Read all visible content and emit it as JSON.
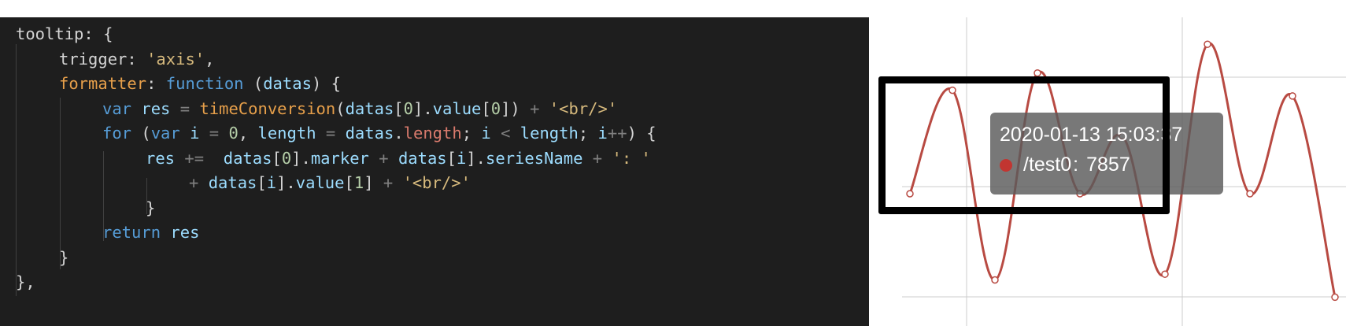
{
  "code": {
    "lines": [
      {
        "tokens": [
          {
            "t": "tooltip: {",
            "c": "tok-plain"
          }
        ]
      },
      {
        "tokens": [
          {
            "t": "trigger: ",
            "c": "tok-plain"
          },
          {
            "t": "'axis'",
            "c": "tok-str"
          },
          {
            "t": ",",
            "c": "tok-plain"
          }
        ]
      },
      {
        "tokens": [
          {
            "t": "formatter",
            "c": "tok-fn2"
          },
          {
            "t": ": ",
            "c": "tok-plain"
          },
          {
            "t": "function",
            "c": "tok-kw"
          },
          {
            "t": " (",
            "c": "tok-plain"
          },
          {
            "t": "datas",
            "c": "tok-var"
          },
          {
            "t": ") {",
            "c": "tok-plain"
          }
        ]
      },
      {
        "tokens": [
          {
            "t": "var ",
            "c": "tok-kw"
          },
          {
            "t": "res",
            "c": "tok-var"
          },
          {
            "t": " = ",
            "c": "tok-op"
          },
          {
            "t": "timeConversion",
            "c": "tok-fn2"
          },
          {
            "t": "(",
            "c": "tok-plain"
          },
          {
            "t": "datas",
            "c": "tok-var"
          },
          {
            "t": "[",
            "c": "tok-plain"
          },
          {
            "t": "0",
            "c": "tok-num"
          },
          {
            "t": "].",
            "c": "tok-plain"
          },
          {
            "t": "value",
            "c": "tok-var"
          },
          {
            "t": "[",
            "c": "tok-plain"
          },
          {
            "t": "0",
            "c": "tok-num"
          },
          {
            "t": "]) ",
            "c": "tok-plain"
          },
          {
            "t": "+ ",
            "c": "tok-op"
          },
          {
            "t": "'<br/>'",
            "c": "tok-str"
          }
        ]
      },
      {
        "tokens": [
          {
            "t": "for",
            "c": "tok-kw"
          },
          {
            "t": " (",
            "c": "tok-plain"
          },
          {
            "t": "var ",
            "c": "tok-kw"
          },
          {
            "t": "i",
            "c": "tok-var"
          },
          {
            "t": " = ",
            "c": "tok-op"
          },
          {
            "t": "0",
            "c": "tok-num"
          },
          {
            "t": ", ",
            "c": "tok-plain"
          },
          {
            "t": "length",
            "c": "tok-var"
          },
          {
            "t": " = ",
            "c": "tok-op"
          },
          {
            "t": "datas",
            "c": "tok-var"
          },
          {
            "t": ".",
            "c": "tok-plain"
          },
          {
            "t": "length",
            "c": "tok-prop3"
          },
          {
            "t": "; ",
            "c": "tok-plain"
          },
          {
            "t": "i",
            "c": "tok-var"
          },
          {
            "t": " < ",
            "c": "tok-op"
          },
          {
            "t": "length",
            "c": "tok-var"
          },
          {
            "t": "; ",
            "c": "tok-plain"
          },
          {
            "t": "i",
            "c": "tok-var"
          },
          {
            "t": "++",
            "c": "tok-op"
          },
          {
            "t": ") {",
            "c": "tok-plain"
          }
        ]
      },
      {
        "tokens": [
          {
            "t": "res",
            "c": "tok-var"
          },
          {
            "t": " +=  ",
            "c": "tok-op"
          },
          {
            "t": "datas",
            "c": "tok-var"
          },
          {
            "t": "[",
            "c": "tok-plain"
          },
          {
            "t": "0",
            "c": "tok-num"
          },
          {
            "t": "].",
            "c": "tok-plain"
          },
          {
            "t": "marker",
            "c": "tok-var"
          },
          {
            "t": " + ",
            "c": "tok-op"
          },
          {
            "t": "datas",
            "c": "tok-var"
          },
          {
            "t": "[",
            "c": "tok-plain"
          },
          {
            "t": "i",
            "c": "tok-var"
          },
          {
            "t": "].",
            "c": "tok-plain"
          },
          {
            "t": "seriesName",
            "c": "tok-var"
          },
          {
            "t": " + ",
            "c": "tok-op"
          },
          {
            "t": "': '",
            "c": "tok-str"
          }
        ]
      },
      {
        "tokens": [
          {
            "t": "+ ",
            "c": "tok-op"
          },
          {
            "t": "datas",
            "c": "tok-var"
          },
          {
            "t": "[",
            "c": "tok-plain"
          },
          {
            "t": "i",
            "c": "tok-var"
          },
          {
            "t": "].",
            "c": "tok-plain"
          },
          {
            "t": "value",
            "c": "tok-var"
          },
          {
            "t": "[",
            "c": "tok-plain"
          },
          {
            "t": "1",
            "c": "tok-num"
          },
          {
            "t": "] ",
            "c": "tok-plain"
          },
          {
            "t": "+ ",
            "c": "tok-op"
          },
          {
            "t": "'<br/>'",
            "c": "tok-str"
          }
        ]
      },
      {
        "tokens": [
          {
            "t": "}",
            "c": "tok-plain"
          }
        ]
      },
      {
        "tokens": [
          {
            "t": "return ",
            "c": "tok-kw"
          },
          {
            "t": "res",
            "c": "tok-var"
          }
        ]
      },
      {
        "tokens": [
          {
            "t": "}",
            "c": "tok-plain"
          }
        ]
      },
      {
        "tokens": [
          {
            "t": "},",
            "c": "tok-plain"
          }
        ]
      }
    ]
  },
  "tooltip": {
    "time": "2020-01-13 15:03:37",
    "series_name": "/test0",
    "separator": ":",
    "value": "7857"
  },
  "colors": {
    "series": "#b84a42",
    "marker": "#c23531",
    "highlight_border": "#000000",
    "gridline": "#cccccc"
  },
  "chart_data": {
    "type": "line",
    "title": "",
    "xlabel": "",
    "ylabel": "",
    "series": [
      {
        "values": [
          0.4,
          0.76,
          0.1,
          0.82,
          0.4,
          0.6,
          0.12,
          0.92,
          0.4,
          0.74,
          0.04
        ]
      }
    ],
    "grid": true,
    "smooth": true,
    "show_symbols": true
  }
}
